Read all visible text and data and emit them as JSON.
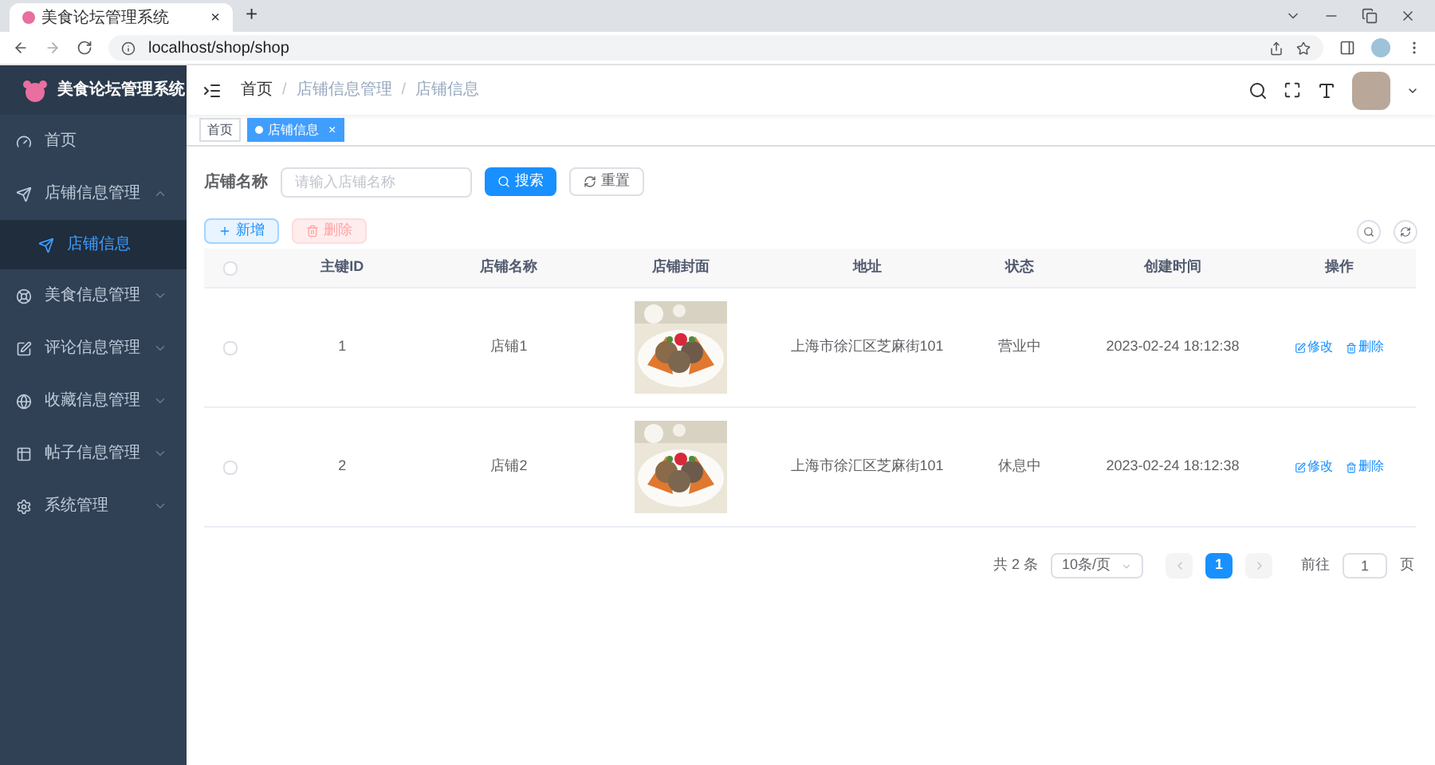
{
  "browser": {
    "tab_title": "美食论坛管理系统",
    "tab_close": "×",
    "new_tab": "+",
    "url": "localhost/shop/shop"
  },
  "sidebar": {
    "title": "美食论坛管理系统",
    "items": [
      {
        "label": "首页",
        "selected": false
      },
      {
        "label": "店铺信息管理",
        "expanded": true,
        "children": [
          {
            "label": "店铺信息",
            "selected": true
          }
        ]
      },
      {
        "label": "美食信息管理",
        "expanded": false
      },
      {
        "label": "评论信息管理",
        "expanded": false
      },
      {
        "label": "收藏信息管理",
        "expanded": false
      },
      {
        "label": "帖子信息管理",
        "expanded": false
      },
      {
        "label": "系统管理",
        "expanded": false
      }
    ]
  },
  "breadcrumb": [
    "首页",
    "店铺信息管理",
    "店铺信息"
  ],
  "breadcrumb_separator": "/",
  "tags": [
    {
      "label": "首页",
      "selected": false
    },
    {
      "label": "店铺信息",
      "selected": true,
      "close": "×"
    }
  ],
  "search": {
    "label": "店铺名称",
    "placeholder": "请输入店铺名称",
    "search_button": "搜索",
    "reset_button": "重置"
  },
  "actions": {
    "add": "新增",
    "delete": "删除"
  },
  "table": {
    "all_checked": false,
    "columns": [
      "主键ID",
      "店铺名称",
      "店铺封面",
      "地址",
      "状态",
      "创建时间",
      "操作"
    ],
    "rows": [
      {
        "checked": false,
        "id": "1",
        "name": "店铺1",
        "address": "上海市徐汇区芝麻街101",
        "status": "营业中",
        "created": "2023-02-24 18:12:38",
        "edit": "修改",
        "delete": "删除"
      },
      {
        "checked": false,
        "id": "2",
        "name": "店铺2",
        "address": "上海市徐汇区芝麻街101",
        "status": "休息中",
        "created": "2023-02-24 18:12:38",
        "edit": "修改",
        "delete": "删除"
      }
    ]
  },
  "pagination": {
    "total": "共 2 条",
    "page_size": "10条/页",
    "pages": [
      {
        "label": "1",
        "selected": true
      }
    ],
    "goto_label": "前往",
    "goto_value": "1",
    "goto_suffix": "页"
  }
}
